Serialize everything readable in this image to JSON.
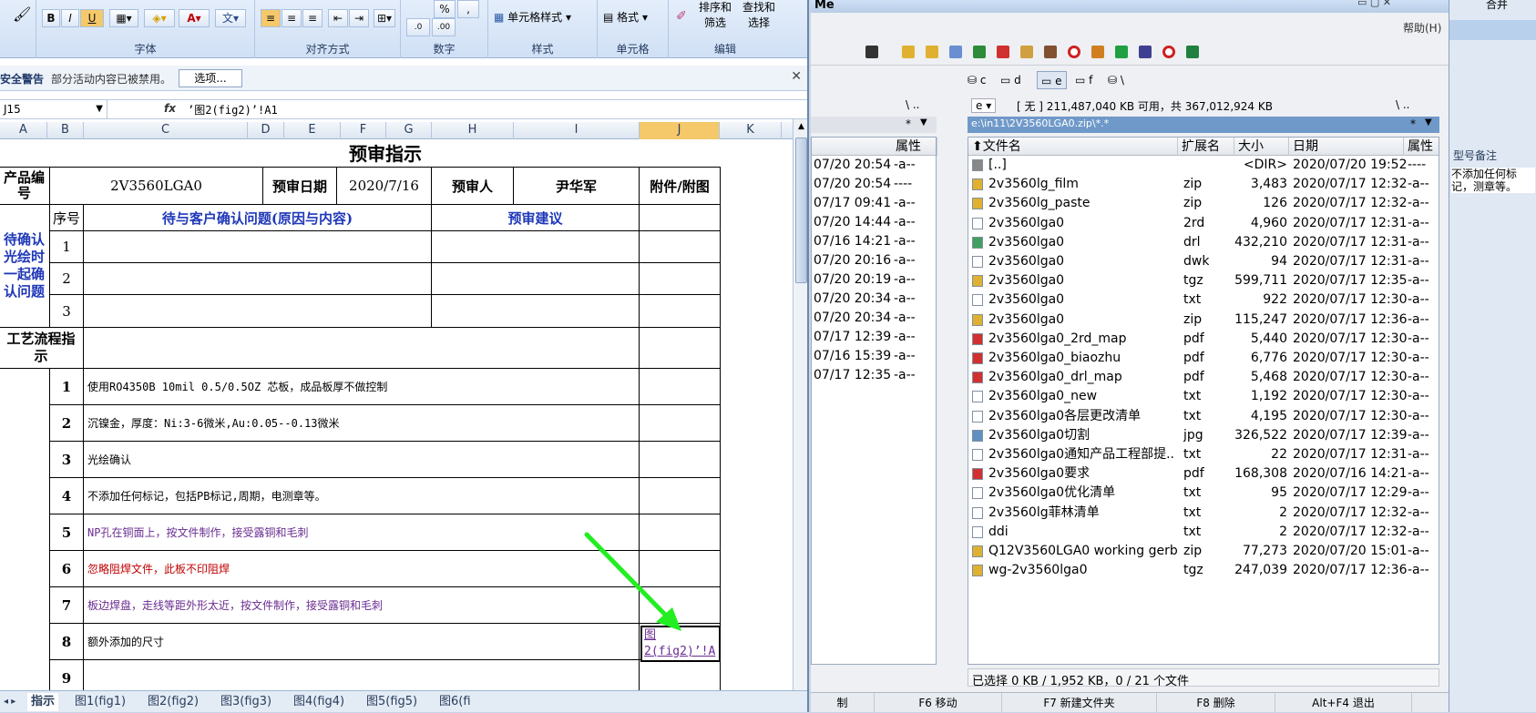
{
  "ribbon": {
    "group_font": "字体",
    "group_align": "对齐方式",
    "group_number": "数字",
    "group_styles": "样式",
    "group_cells": "单元格",
    "group_edit": "编辑",
    "cell_styles": "单元格样式",
    "format": "格式",
    "sort_filter": "排序和\n筛选",
    "find_select": "查找和\n选择",
    "percent": "%",
    "comma": ","
  },
  "security": {
    "title": "安全警告",
    "message": "部分活动内容已被禁用。",
    "options": "选项..."
  },
  "formula_bar": {
    "namebox": "J15",
    "fx": "fx",
    "formula": "’图2(fig2)’!A1"
  },
  "columns": [
    "A",
    "B",
    "C",
    "D",
    "E",
    "F",
    "G",
    "H",
    "I",
    "J",
    "K"
  ],
  "sheet": {
    "title": "预审指示",
    "h_product_code": "产品编号",
    "product_code": "2V3560LGA0",
    "h_review_date": "预审日期",
    "review_date": "2020/7/16",
    "h_reviewer": "预审人",
    "reviewer": "尹华军",
    "h_attach": "附件/附图",
    "section1": "待确认光绘时一起确认问题",
    "h_seq": "序号",
    "h_issue": "待与客户确认问题(原因与内容)",
    "h_suggest": "预审建议",
    "issue_rows": [
      "1",
      "2",
      "3"
    ],
    "section2": "工艺流程指示",
    "steps": [
      {
        "no": "1",
        "text": "使用RO4350B 10mil 0.5/0.5OZ 芯板，成品板厚不做控制",
        "color": "#000000"
      },
      {
        "no": "2",
        "text": "沉镍金，厚度：Ni:3-6微米,Au:0.05--0.13微米",
        "color": "#000000"
      },
      {
        "no": "3",
        "text": "光绘确认",
        "color": "#000000"
      },
      {
        "no": "4",
        "text": "不添加任何标记，包括PB标记,周期，电测章等。",
        "color": "#000000"
      },
      {
        "no": "5",
        "text": "NP孔在铜面上，按文件制作，接受露铜和毛刺",
        "color": "#6a2c91"
      },
      {
        "no": "6",
        "text": "忽略阻焊文件，此板不印阻焊",
        "color": "#c00000"
      },
      {
        "no": "7",
        "text": "板边焊盘，走线等距外形太近，按文件制作，接受露铜和毛刺",
        "color": "#6a2c91"
      },
      {
        "no": "8",
        "text": "额外添加的尺寸",
        "color": "#000000"
      },
      {
        "no": "9",
        "text": "",
        "color": "#000000"
      }
    ],
    "link_line1": "图",
    "link_line2": "2(fig2)’!A"
  },
  "tabs": [
    "指示",
    "图1(fig1)",
    "图2(fig2)",
    "图3(fig3)",
    "图4(fig4)",
    "图5(fig5)",
    "图6(fi"
  ],
  "tc": {
    "title_partial": "Me",
    "help": "帮助(H)",
    "drives": [
      "c",
      "d",
      "e",
      "f",
      "\\"
    ],
    "left_drive_nav": "\\  ..",
    "right_drive": "e",
    "right_space": "[ 无 ]  211,487,040 KB 可用，共 367,012,924 KB",
    "right_nav": "\\  ..",
    "right_path": "e:\\in11\\2V3560LGA0.zip\\*.*",
    "filter": "*",
    "left_header_attr": "属性",
    "left_rows": [
      {
        "date": "07/20 20:54",
        "attr": "-a--"
      },
      {
        "date": "07/20 20:54",
        "attr": "----"
      },
      {
        "date": "07/17 09:41",
        "attr": "-a--"
      },
      {
        "date": "07/20 14:44",
        "attr": "-a--"
      },
      {
        "date": "07/16 14:21",
        "attr": "-a--"
      },
      {
        "date": "07/20 20:16",
        "attr": "-a--"
      },
      {
        "date": "07/20 20:19",
        "attr": "-a--"
      },
      {
        "date": "07/20 20:34",
        "attr": "-a--"
      },
      {
        "date": "07/20 20:34",
        "attr": "-a--"
      },
      {
        "date": "07/17 12:39",
        "attr": "-a--"
      },
      {
        "date": "07/16 15:39",
        "attr": "-a--"
      },
      {
        "date": "07/17 12:35",
        "attr": "-a--"
      }
    ],
    "headers": {
      "name": "文件名",
      "ext": "扩展名",
      "size": "大小",
      "date": "日期",
      "attr": "属性"
    },
    "files": [
      {
        "name": "[..]",
        "ext": "",
        "size": "<DIR>",
        "date": "2020/07/20 19:52",
        "attr": "----",
        "icon": "up"
      },
      {
        "name": "2v3560lg_film",
        "ext": "zip",
        "size": "3,483",
        "date": "2020/07/17 12:32",
        "attr": "-a--",
        "icon": "zip"
      },
      {
        "name": "2v3560lg_paste",
        "ext": "zip",
        "size": "126",
        "date": "2020/07/17 12:32",
        "attr": "-a--",
        "icon": "zip"
      },
      {
        "name": "2v3560lga0",
        "ext": "2rd",
        "size": "4,960",
        "date": "2020/07/17 12:31",
        "attr": "-a--",
        "icon": "doc"
      },
      {
        "name": "2v3560lga0",
        "ext": "drl",
        "size": "432,210",
        "date": "2020/07/17 12:31",
        "attr": "-a--",
        "icon": "drl"
      },
      {
        "name": "2v3560lga0",
        "ext": "dwk",
        "size": "94",
        "date": "2020/07/17 12:31",
        "attr": "-a--",
        "icon": "doc"
      },
      {
        "name": "2v3560lga0",
        "ext": "tgz",
        "size": "599,711",
        "date": "2020/07/17 12:35",
        "attr": "-a--",
        "icon": "zip"
      },
      {
        "name": "2v3560lga0",
        "ext": "txt",
        "size": "922",
        "date": "2020/07/17 12:30",
        "attr": "-a--",
        "icon": "doc"
      },
      {
        "name": "2v3560lga0",
        "ext": "zip",
        "size": "115,247",
        "date": "2020/07/17 12:36",
        "attr": "-a--",
        "icon": "zip"
      },
      {
        "name": "2v3560lga0_2rd_map",
        "ext": "pdf",
        "size": "5,440",
        "date": "2020/07/17 12:30",
        "attr": "-a--",
        "icon": "pdf"
      },
      {
        "name": "2v3560lga0_biaozhu",
        "ext": "pdf",
        "size": "6,776",
        "date": "2020/07/17 12:30",
        "attr": "-a--",
        "icon": "pdf"
      },
      {
        "name": "2v3560lga0_drl_map",
        "ext": "pdf",
        "size": "5,468",
        "date": "2020/07/17 12:30",
        "attr": "-a--",
        "icon": "pdf"
      },
      {
        "name": "2v3560lga0_new",
        "ext": "txt",
        "size": "1,192",
        "date": "2020/07/17 12:30",
        "attr": "-a--",
        "icon": "doc"
      },
      {
        "name": "2v3560lga0各层更改清单",
        "ext": "txt",
        "size": "4,195",
        "date": "2020/07/17 12:30",
        "attr": "-a--",
        "icon": "doc"
      },
      {
        "name": "2v3560lga0切割",
        "ext": "jpg",
        "size": "326,522",
        "date": "2020/07/17 12:39",
        "attr": "-a--",
        "icon": "img"
      },
      {
        "name": "2v3560lga0通知产品工程部提..",
        "ext": "txt",
        "size": "22",
        "date": "2020/07/17 12:31",
        "attr": "-a--",
        "icon": "doc"
      },
      {
        "name": "2v3560lga0要求",
        "ext": "pdf",
        "size": "168,308",
        "date": "2020/07/16 14:21",
        "attr": "-a--",
        "icon": "pdf"
      },
      {
        "name": "2v3560lga0优化清单",
        "ext": "txt",
        "size": "95",
        "date": "2020/07/17 12:29",
        "attr": "-a--",
        "icon": "doc"
      },
      {
        "name": "2v3560lg菲林清单",
        "ext": "txt",
        "size": "2",
        "date": "2020/07/17 12:32",
        "attr": "-a--",
        "icon": "doc"
      },
      {
        "name": "ddi",
        "ext": "txt",
        "size": "2",
        "date": "2020/07/17 12:32",
        "attr": "-a--",
        "icon": "doc"
      },
      {
        "name": "Q12V3560LGA0 working gerb..",
        "ext": "zip",
        "size": "77,273",
        "date": "2020/07/20 15:01",
        "attr": "-a--",
        "icon": "zip"
      },
      {
        "name": "wg-2v3560lga0",
        "ext": "tgz",
        "size": "247,039",
        "date": "2020/07/17 12:36",
        "attr": "-a--",
        "icon": "zip"
      }
    ],
    "status": "已选择 0 KB / 1,952 KB，0 / 21 个文件",
    "fkeys": [
      "制",
      "F6 移动",
      "F7 新建文件夹",
      "F8 删除",
      "Alt+F4 退出"
    ]
  },
  "far_right": {
    "top": "合并",
    "header": "型号备注",
    "note": "不添加任何标记，测章等。"
  },
  "colors": {
    "arrow": "#22ee22",
    "selection": "#f5c86a"
  }
}
